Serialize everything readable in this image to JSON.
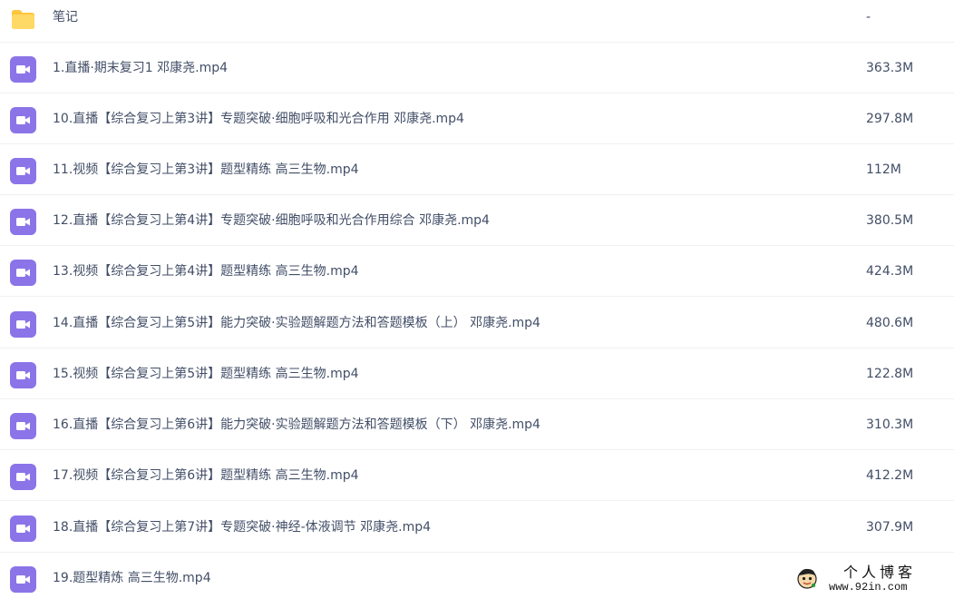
{
  "files": [
    {
      "name": "笔记",
      "size": "-",
      "type": "folder",
      "icon": "folder-icon"
    },
    {
      "name": "1.直播·期末复习1 邓康尧.mp4",
      "size": "363.3M",
      "type": "video",
      "icon": "video-file-icon"
    },
    {
      "name": "10.直播【综合复习上第3讲】专题突破·细胞呼吸和光合作用 邓康尧.mp4",
      "size": "297.8M",
      "type": "video",
      "icon": "video-file-icon"
    },
    {
      "name": "11.视频【综合复习上第3讲】题型精练 高三生物.mp4",
      "size": "112M",
      "type": "video",
      "icon": "video-file-icon"
    },
    {
      "name": "12.直播【综合复习上第4讲】专题突破·细胞呼吸和光合作用综合 邓康尧.mp4",
      "size": "380.5M",
      "type": "video",
      "icon": "video-file-icon"
    },
    {
      "name": "13.视频【综合复习上第4讲】题型精练 高三生物.mp4",
      "size": "424.3M",
      "type": "video",
      "icon": "video-file-icon"
    },
    {
      "name": "14.直播【综合复习上第5讲】能力突破·实验题解题方法和答题模板（上） 邓康尧.mp4",
      "size": "480.6M",
      "type": "video",
      "icon": "video-file-icon"
    },
    {
      "name": "15.视频【综合复习上第5讲】题型精练 高三生物.mp4",
      "size": "122.8M",
      "type": "video",
      "icon": "video-file-icon"
    },
    {
      "name": "16.直播【综合复习上第6讲】能力突破·实验题解题方法和答题模板（下） 邓康尧.mp4",
      "size": "310.3M",
      "type": "video",
      "icon": "video-file-icon"
    },
    {
      "name": "17.视频【综合复习上第6讲】题型精练 高三生物.mp4",
      "size": "412.2M",
      "type": "video",
      "icon": "video-file-icon"
    },
    {
      "name": "18.直播【综合复习上第7讲】专题突破·神经-体液调节 邓康尧.mp4",
      "size": "307.9M",
      "type": "video",
      "icon": "video-file-icon"
    },
    {
      "name": "19.题型精炼 高三生物.mp4",
      "size": "",
      "type": "video",
      "icon": "video-file-icon"
    }
  ],
  "watermark": {
    "title": "个人博客",
    "url": "www.92in.com"
  },
  "colors": {
    "text": "#424e67",
    "video_icon": "#8b74e8",
    "folder_icon": "#ffcf48",
    "divider": "#f0f1f4"
  }
}
